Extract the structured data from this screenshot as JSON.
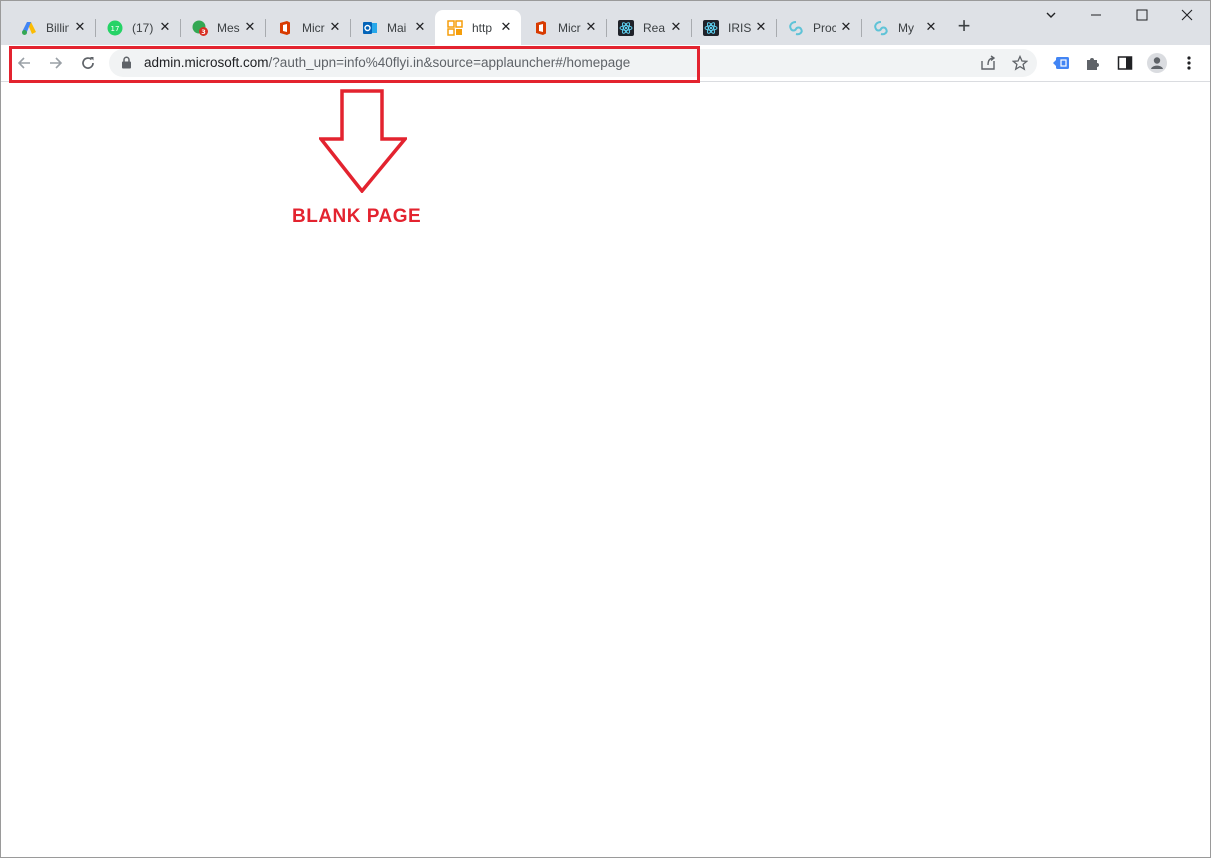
{
  "tabs": [
    {
      "title": "Billin",
      "icon": "google-ads-icon"
    },
    {
      "title": "(17)",
      "icon": "whatsapp-icon",
      "badge": "17"
    },
    {
      "title": "Mes",
      "icon": "messages-icon",
      "badge": "3"
    },
    {
      "title": "Micr",
      "icon": "office-icon"
    },
    {
      "title": "Mai",
      "icon": "outlook-icon"
    },
    {
      "title": "http",
      "icon": "admin-icon",
      "active": true
    },
    {
      "title": "Micr",
      "icon": "office-icon"
    },
    {
      "title": "Rea",
      "icon": "react-icon"
    },
    {
      "title": "IRIS",
      "icon": "react-icon"
    },
    {
      "title": "Proc",
      "icon": "azure-icon"
    },
    {
      "title": "My",
      "icon": "azure-icon"
    }
  ],
  "address": {
    "host": "admin.microsoft.com",
    "path": "/?auth_upn=info%40flyi.in&source=applauncher#/homepage"
  },
  "annotation": {
    "label": "BLANK PAGE",
    "color": "#e3232f"
  },
  "colors": {
    "tabstrip": "#dee1e6",
    "accent": "#1a73e8"
  }
}
